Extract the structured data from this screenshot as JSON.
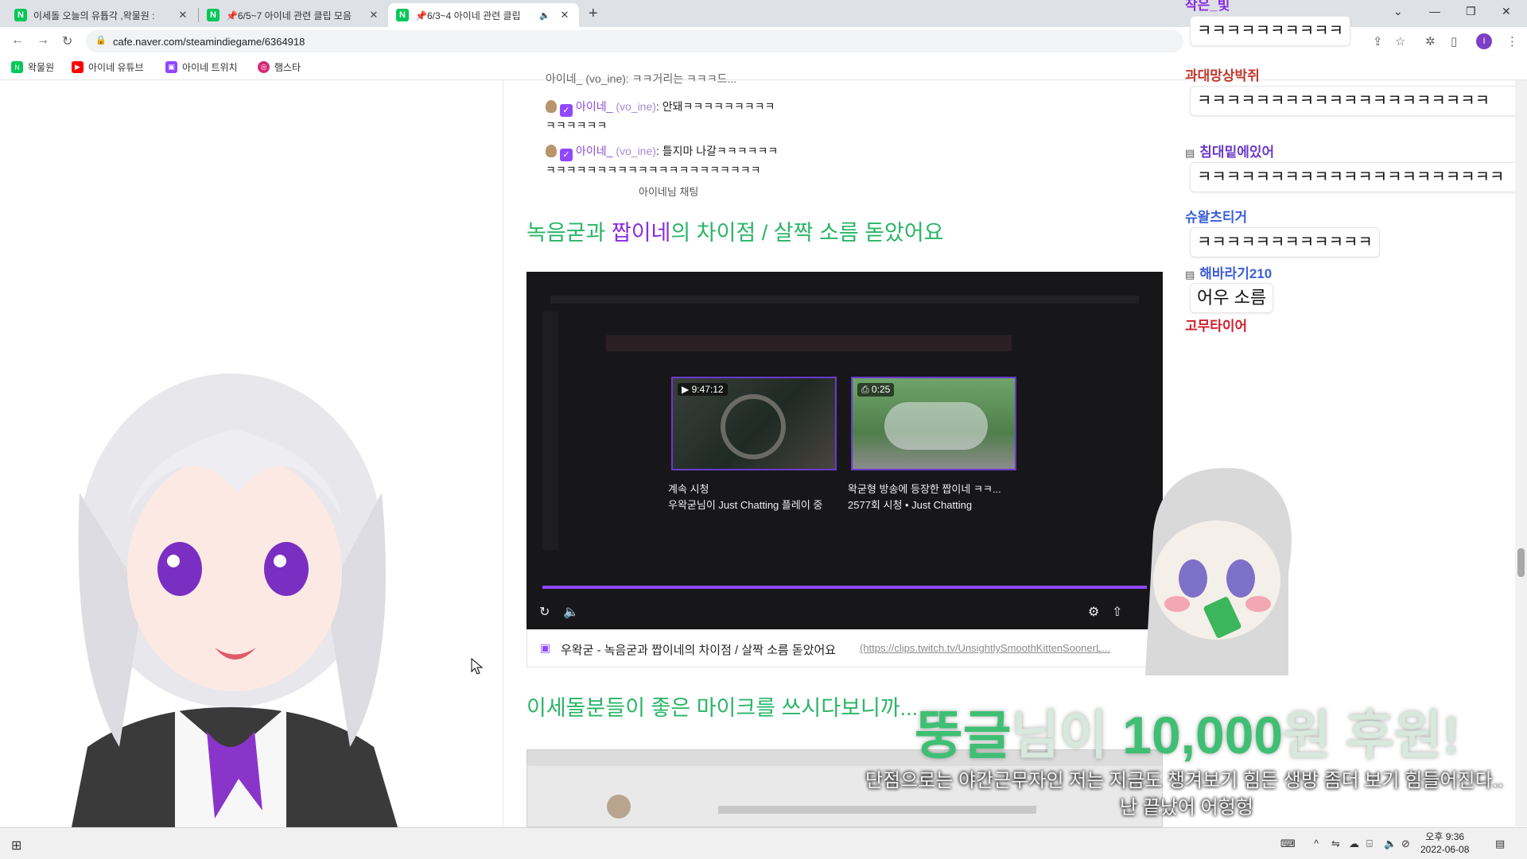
{
  "browser": {
    "tabs": [
      {
        "title": "이세돌 오늘의 유튭각 ,왁물원 :",
        "close": "✕"
      },
      {
        "title": "📌6/5~7 아이네 관련 클립 모음",
        "close": "✕"
      },
      {
        "title": "📌6/3~4 아이네 관련 클립",
        "close": "✕",
        "audio": "🔈"
      }
    ],
    "new_tab": "+",
    "url": "cafe.naver.com/steamindiegame/6364918",
    "bookmarks": [
      {
        "label": "왁물원",
        "icon": "naver-cafe-icon",
        "color": "#03c75a"
      },
      {
        "label": "아이네 유튜브",
        "icon": "youtube-icon",
        "color": "#ff0000"
      },
      {
        "label": "아이네 트위치",
        "icon": "twitch-icon",
        "color": "#9147ff"
      },
      {
        "label": "햄스타",
        "icon": "instagram-icon",
        "color": "#d62976"
      }
    ],
    "profile_initial": "I"
  },
  "article": {
    "chat": [
      {
        "nick": "아이네_",
        "handle": "(vo_ine)",
        "text": ": 안돼ㅋㅋㅋㅋㅋㅋㅋㅋㅋ",
        "cont": "ㅋㅋㅋㅋㅋㅋ"
      },
      {
        "nick": "아이네_",
        "handle": "(vo_ine)",
        "text": ": 틀지마 나갈ㅋㅋㅋㅋㅋㅋ",
        "cont": "ㅋㅋㅋㅋㅋㅋㅋㅋㅋㅋㅋㅋㅋㅋㅋㅋㅋㅋㅋㅋㅋ"
      }
    ],
    "chat_top_partial": "아이네_ (vo_ine): ㅋㅋ거리는 ㅋㅋㅋ드...",
    "chat_caption": "아이네님 채팅",
    "heading1_a": "녹음굳과 ",
    "heading1_b": "짭이네",
    "heading1_c": "의 차이점 / 살짝 소름 돋았어요",
    "video": {
      "thumb1_badge": "▶ 9:47:12",
      "thumb1_title": "계속 시청",
      "thumb1_sub": "우왁굳님이 Just Chatting 플레이 중",
      "thumb2_badge": "⎙ 0:25",
      "thumb2_title": "왁굳형 방송에 등장한 짭이네 ㅋㅋ...",
      "thumb2_sub": "2577회 시청 • Just Chatting"
    },
    "link_title": "우왁굳 - 녹음굳과 짭이네의 차이점 / 살짝 소름 돋았어요",
    "link_url": "(https://clips.twitch.tv/UnsightlySmoothKittenSoonerL...",
    "heading2": "이세돌분들이 좋은 마이크를 쓰시다보니까..."
  },
  "sidechat": {
    "messages": [
      {
        "name": "작은_빛",
        "color": "#8a2be2",
        "text": "ㅋㅋㅋㅋㅋㅋㅋㅋㅋㅋ"
      },
      {
        "name": "과대망상박쥐",
        "color": "#c0392b",
        "text": "ㅋㅋㅋㅋㅋㅋㅋㅋㅋㅋㅋㅋㅋㅋㅋㅋㅋㅋㅋㅋ"
      },
      {
        "name": "침대밑에있어",
        "color": "#6a3acb",
        "text": "ㅋㅋㅋㅋㅋㅋㅋㅋㅋㅋㅋㅋㅋㅋㅋㅋㅋㅋㅋㅋㅋ"
      },
      {
        "name": "슈왈츠티거",
        "color": "#3b5fd8",
        "text": "ㅋㅋㅋㅋㅋㅋㅋㅋㅋㅋㅋㅋ"
      },
      {
        "name": "해바라기210",
        "color": "#3b5fd8",
        "text": "어우 소름"
      },
      {
        "name": "고무타이어",
        "color": "#d0202e",
        "text": ""
      }
    ]
  },
  "donation": {
    "name": "뚱글",
    "mid": "님이 ",
    "amount": "10,000",
    "suffix": "원 후원!",
    "message_line1": "단점으로는 야간근무자인 저는 지금도 챙겨보기 힘든 생방 좀더 보기 힘들어진다..",
    "message_line2": "난 끝났어 어헝헝"
  },
  "taskbar": {
    "time": "오후 9:36",
    "date": "2022-06-08"
  }
}
